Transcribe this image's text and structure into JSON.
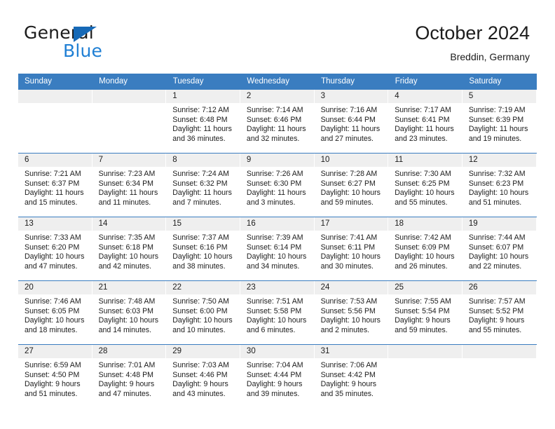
{
  "logo": {
    "line1": "General",
    "line2": "Blue",
    "triangle_icon": "blue-triangle-icon",
    "color_dark": "#1c1c1c",
    "color_blue": "#1f7fd4"
  },
  "header": {
    "title": "October 2024",
    "subtitle": "Breddin, Germany"
  },
  "theme": {
    "header_blue": "#3a7dc0",
    "daynum_bg": "#efefef",
    "text": "#1c1c1c"
  },
  "weekdays": [
    "Sunday",
    "Monday",
    "Tuesday",
    "Wednesday",
    "Thursday",
    "Friday",
    "Saturday"
  ],
  "labels": {
    "sunrise": "Sunrise:",
    "sunset": "Sunset:",
    "daylight": "Daylight:"
  },
  "weeks": [
    [
      {
        "day": "",
        "empty": true
      },
      {
        "day": "",
        "empty": true
      },
      {
        "day": "1",
        "sunrise": "Sunrise: 7:12 AM",
        "sunset": "Sunset: 6:48 PM",
        "daylight1": "Daylight: 11 hours",
        "daylight2": "and 36 minutes."
      },
      {
        "day": "2",
        "sunrise": "Sunrise: 7:14 AM",
        "sunset": "Sunset: 6:46 PM",
        "daylight1": "Daylight: 11 hours",
        "daylight2": "and 32 minutes."
      },
      {
        "day": "3",
        "sunrise": "Sunrise: 7:16 AM",
        "sunset": "Sunset: 6:44 PM",
        "daylight1": "Daylight: 11 hours",
        "daylight2": "and 27 minutes."
      },
      {
        "day": "4",
        "sunrise": "Sunrise: 7:17 AM",
        "sunset": "Sunset: 6:41 PM",
        "daylight1": "Daylight: 11 hours",
        "daylight2": "and 23 minutes."
      },
      {
        "day": "5",
        "sunrise": "Sunrise: 7:19 AM",
        "sunset": "Sunset: 6:39 PM",
        "daylight1": "Daylight: 11 hours",
        "daylight2": "and 19 minutes."
      }
    ],
    [
      {
        "day": "6",
        "sunrise": "Sunrise: 7:21 AM",
        "sunset": "Sunset: 6:37 PM",
        "daylight1": "Daylight: 11 hours",
        "daylight2": "and 15 minutes."
      },
      {
        "day": "7",
        "sunrise": "Sunrise: 7:23 AM",
        "sunset": "Sunset: 6:34 PM",
        "daylight1": "Daylight: 11 hours",
        "daylight2": "and 11 minutes."
      },
      {
        "day": "8",
        "sunrise": "Sunrise: 7:24 AM",
        "sunset": "Sunset: 6:32 PM",
        "daylight1": "Daylight: 11 hours",
        "daylight2": "and 7 minutes."
      },
      {
        "day": "9",
        "sunrise": "Sunrise: 7:26 AM",
        "sunset": "Sunset: 6:30 PM",
        "daylight1": "Daylight: 11 hours",
        "daylight2": "and 3 minutes."
      },
      {
        "day": "10",
        "sunrise": "Sunrise: 7:28 AM",
        "sunset": "Sunset: 6:27 PM",
        "daylight1": "Daylight: 10 hours",
        "daylight2": "and 59 minutes."
      },
      {
        "day": "11",
        "sunrise": "Sunrise: 7:30 AM",
        "sunset": "Sunset: 6:25 PM",
        "daylight1": "Daylight: 10 hours",
        "daylight2": "and 55 minutes."
      },
      {
        "day": "12",
        "sunrise": "Sunrise: 7:32 AM",
        "sunset": "Sunset: 6:23 PM",
        "daylight1": "Daylight: 10 hours",
        "daylight2": "and 51 minutes."
      }
    ],
    [
      {
        "day": "13",
        "sunrise": "Sunrise: 7:33 AM",
        "sunset": "Sunset: 6:20 PM",
        "daylight1": "Daylight: 10 hours",
        "daylight2": "and 47 minutes."
      },
      {
        "day": "14",
        "sunrise": "Sunrise: 7:35 AM",
        "sunset": "Sunset: 6:18 PM",
        "daylight1": "Daylight: 10 hours",
        "daylight2": "and 42 minutes."
      },
      {
        "day": "15",
        "sunrise": "Sunrise: 7:37 AM",
        "sunset": "Sunset: 6:16 PM",
        "daylight1": "Daylight: 10 hours",
        "daylight2": "and 38 minutes."
      },
      {
        "day": "16",
        "sunrise": "Sunrise: 7:39 AM",
        "sunset": "Sunset: 6:14 PM",
        "daylight1": "Daylight: 10 hours",
        "daylight2": "and 34 minutes."
      },
      {
        "day": "17",
        "sunrise": "Sunrise: 7:41 AM",
        "sunset": "Sunset: 6:11 PM",
        "daylight1": "Daylight: 10 hours",
        "daylight2": "and 30 minutes."
      },
      {
        "day": "18",
        "sunrise": "Sunrise: 7:42 AM",
        "sunset": "Sunset: 6:09 PM",
        "daylight1": "Daylight: 10 hours",
        "daylight2": "and 26 minutes."
      },
      {
        "day": "19",
        "sunrise": "Sunrise: 7:44 AM",
        "sunset": "Sunset: 6:07 PM",
        "daylight1": "Daylight: 10 hours",
        "daylight2": "and 22 minutes."
      }
    ],
    [
      {
        "day": "20",
        "sunrise": "Sunrise: 7:46 AM",
        "sunset": "Sunset: 6:05 PM",
        "daylight1": "Daylight: 10 hours",
        "daylight2": "and 18 minutes."
      },
      {
        "day": "21",
        "sunrise": "Sunrise: 7:48 AM",
        "sunset": "Sunset: 6:03 PM",
        "daylight1": "Daylight: 10 hours",
        "daylight2": "and 14 minutes."
      },
      {
        "day": "22",
        "sunrise": "Sunrise: 7:50 AM",
        "sunset": "Sunset: 6:00 PM",
        "daylight1": "Daylight: 10 hours",
        "daylight2": "and 10 minutes."
      },
      {
        "day": "23",
        "sunrise": "Sunrise: 7:51 AM",
        "sunset": "Sunset: 5:58 PM",
        "daylight1": "Daylight: 10 hours",
        "daylight2": "and 6 minutes."
      },
      {
        "day": "24",
        "sunrise": "Sunrise: 7:53 AM",
        "sunset": "Sunset: 5:56 PM",
        "daylight1": "Daylight: 10 hours",
        "daylight2": "and 2 minutes."
      },
      {
        "day": "25",
        "sunrise": "Sunrise: 7:55 AM",
        "sunset": "Sunset: 5:54 PM",
        "daylight1": "Daylight: 9 hours",
        "daylight2": "and 59 minutes."
      },
      {
        "day": "26",
        "sunrise": "Sunrise: 7:57 AM",
        "sunset": "Sunset: 5:52 PM",
        "daylight1": "Daylight: 9 hours",
        "daylight2": "and 55 minutes."
      }
    ],
    [
      {
        "day": "27",
        "sunrise": "Sunrise: 6:59 AM",
        "sunset": "Sunset: 4:50 PM",
        "daylight1": "Daylight: 9 hours",
        "daylight2": "and 51 minutes."
      },
      {
        "day": "28",
        "sunrise": "Sunrise: 7:01 AM",
        "sunset": "Sunset: 4:48 PM",
        "daylight1": "Daylight: 9 hours",
        "daylight2": "and 47 minutes."
      },
      {
        "day": "29",
        "sunrise": "Sunrise: 7:03 AM",
        "sunset": "Sunset: 4:46 PM",
        "daylight1": "Daylight: 9 hours",
        "daylight2": "and 43 minutes."
      },
      {
        "day": "30",
        "sunrise": "Sunrise: 7:04 AM",
        "sunset": "Sunset: 4:44 PM",
        "daylight1": "Daylight: 9 hours",
        "daylight2": "and 39 minutes."
      },
      {
        "day": "31",
        "sunrise": "Sunrise: 7:06 AM",
        "sunset": "Sunset: 4:42 PM",
        "daylight1": "Daylight: 9 hours",
        "daylight2": "and 35 minutes."
      },
      {
        "day": "",
        "empty": true
      },
      {
        "day": "",
        "empty": true
      }
    ]
  ]
}
